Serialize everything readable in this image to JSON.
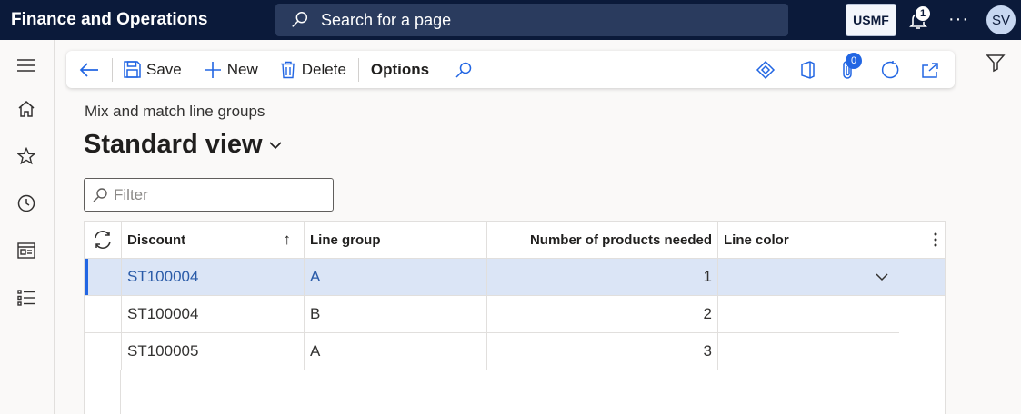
{
  "topbar": {
    "app_title": "Finance and Operations",
    "search_placeholder": "Search for a page",
    "company": "USMF",
    "notification_count": "1",
    "more": "···",
    "avatar_initials": "SV"
  },
  "actions": {
    "save": "Save",
    "new": "New",
    "delete": "Delete",
    "options": "Options",
    "attachments_count": "0"
  },
  "page": {
    "caption": "Mix and match line groups",
    "view_title": "Standard view"
  },
  "filter": {
    "placeholder": "Filter"
  },
  "grid": {
    "columns": [
      "Discount",
      "Line group",
      "Number of products needed",
      "Line color"
    ],
    "sort_indicator": "↑",
    "rows": [
      {
        "discount": "ST100004",
        "line_group": "A",
        "products_needed": "1",
        "line_color": ""
      },
      {
        "discount": "ST100004",
        "line_group": "B",
        "products_needed": "2",
        "line_color": ""
      },
      {
        "discount": "ST100005",
        "line_group": "A",
        "products_needed": "3",
        "line_color": ""
      }
    ]
  },
  "colors": {
    "nav_bar": "#0b1a3a",
    "accent": "#2266e3",
    "selected_row": "#dbe5f6"
  }
}
